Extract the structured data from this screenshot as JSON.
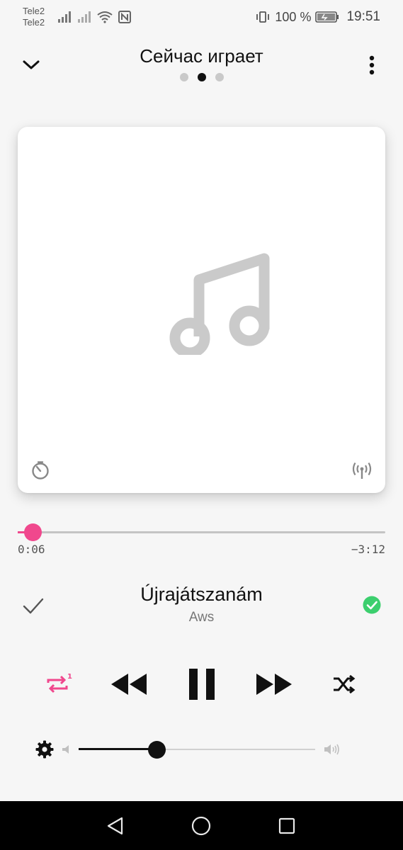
{
  "status_bar": {
    "carrier_1": "Tele2",
    "carrier_2": "Tele2",
    "battery": "100 %",
    "time": "19:51"
  },
  "header": {
    "title": "Сейчас играет",
    "page_indicator": {
      "pages": 3,
      "active": 2
    }
  },
  "artwork": {
    "placeholder_icon": "music-note-icon",
    "left_icon": "timer-icon",
    "right_icon": "cast-icon"
  },
  "progress": {
    "elapsed": "0:06",
    "remaining": "−3:12",
    "fraction": 0.03
  },
  "track": {
    "title": "Újrajátszanám",
    "artist": "Aws"
  },
  "controls": {
    "repeat_badge": "1",
    "repeat_icon": "repeat-one-icon",
    "rewind_icon": "rewind-icon",
    "pause_icon": "pause-icon",
    "forward_icon": "fast-forward-icon",
    "shuffle_icon": "shuffle-icon"
  },
  "volume": {
    "level": 0.33
  },
  "colors": {
    "accent": "#f0488d",
    "favorite": "#3ccf6e",
    "background": "#f6f6f6"
  }
}
